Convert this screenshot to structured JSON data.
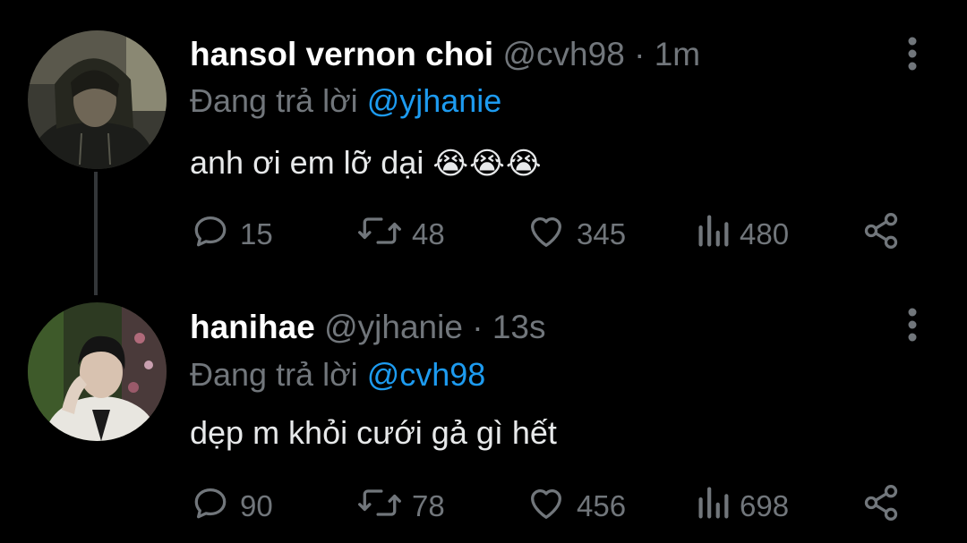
{
  "tweets": [
    {
      "display_name": "hansol vernon choi",
      "handle": "@cvh98",
      "separator": "·",
      "time": "1m",
      "replying_prefix": "Đang trả lời",
      "replying_to": "@yjhanie",
      "text": "anh ơi em lỡ dại",
      "emoji": "😭😭😭",
      "replies": "15",
      "retweets": "48",
      "likes": "345",
      "views": "480"
    },
    {
      "display_name": "hanihae",
      "handle": "@yjhanie",
      "separator": "·",
      "time": "13s",
      "replying_prefix": "Đang trả lời",
      "replying_to": "@cvh98",
      "text": "dẹp m khỏi cưới gả gì hết",
      "emoji": "",
      "replies": "90",
      "retweets": "78",
      "likes": "456",
      "views": "698"
    }
  ],
  "colors": {
    "background": "#000000",
    "text_primary": "#e7e9ea",
    "text_secondary": "#71767b",
    "link": "#1d9bf0",
    "thread_line": "#333639"
  },
  "icons": [
    "reply-icon",
    "retweet-icon",
    "like-icon",
    "views-icon",
    "share-icon",
    "more-options-icon"
  ]
}
